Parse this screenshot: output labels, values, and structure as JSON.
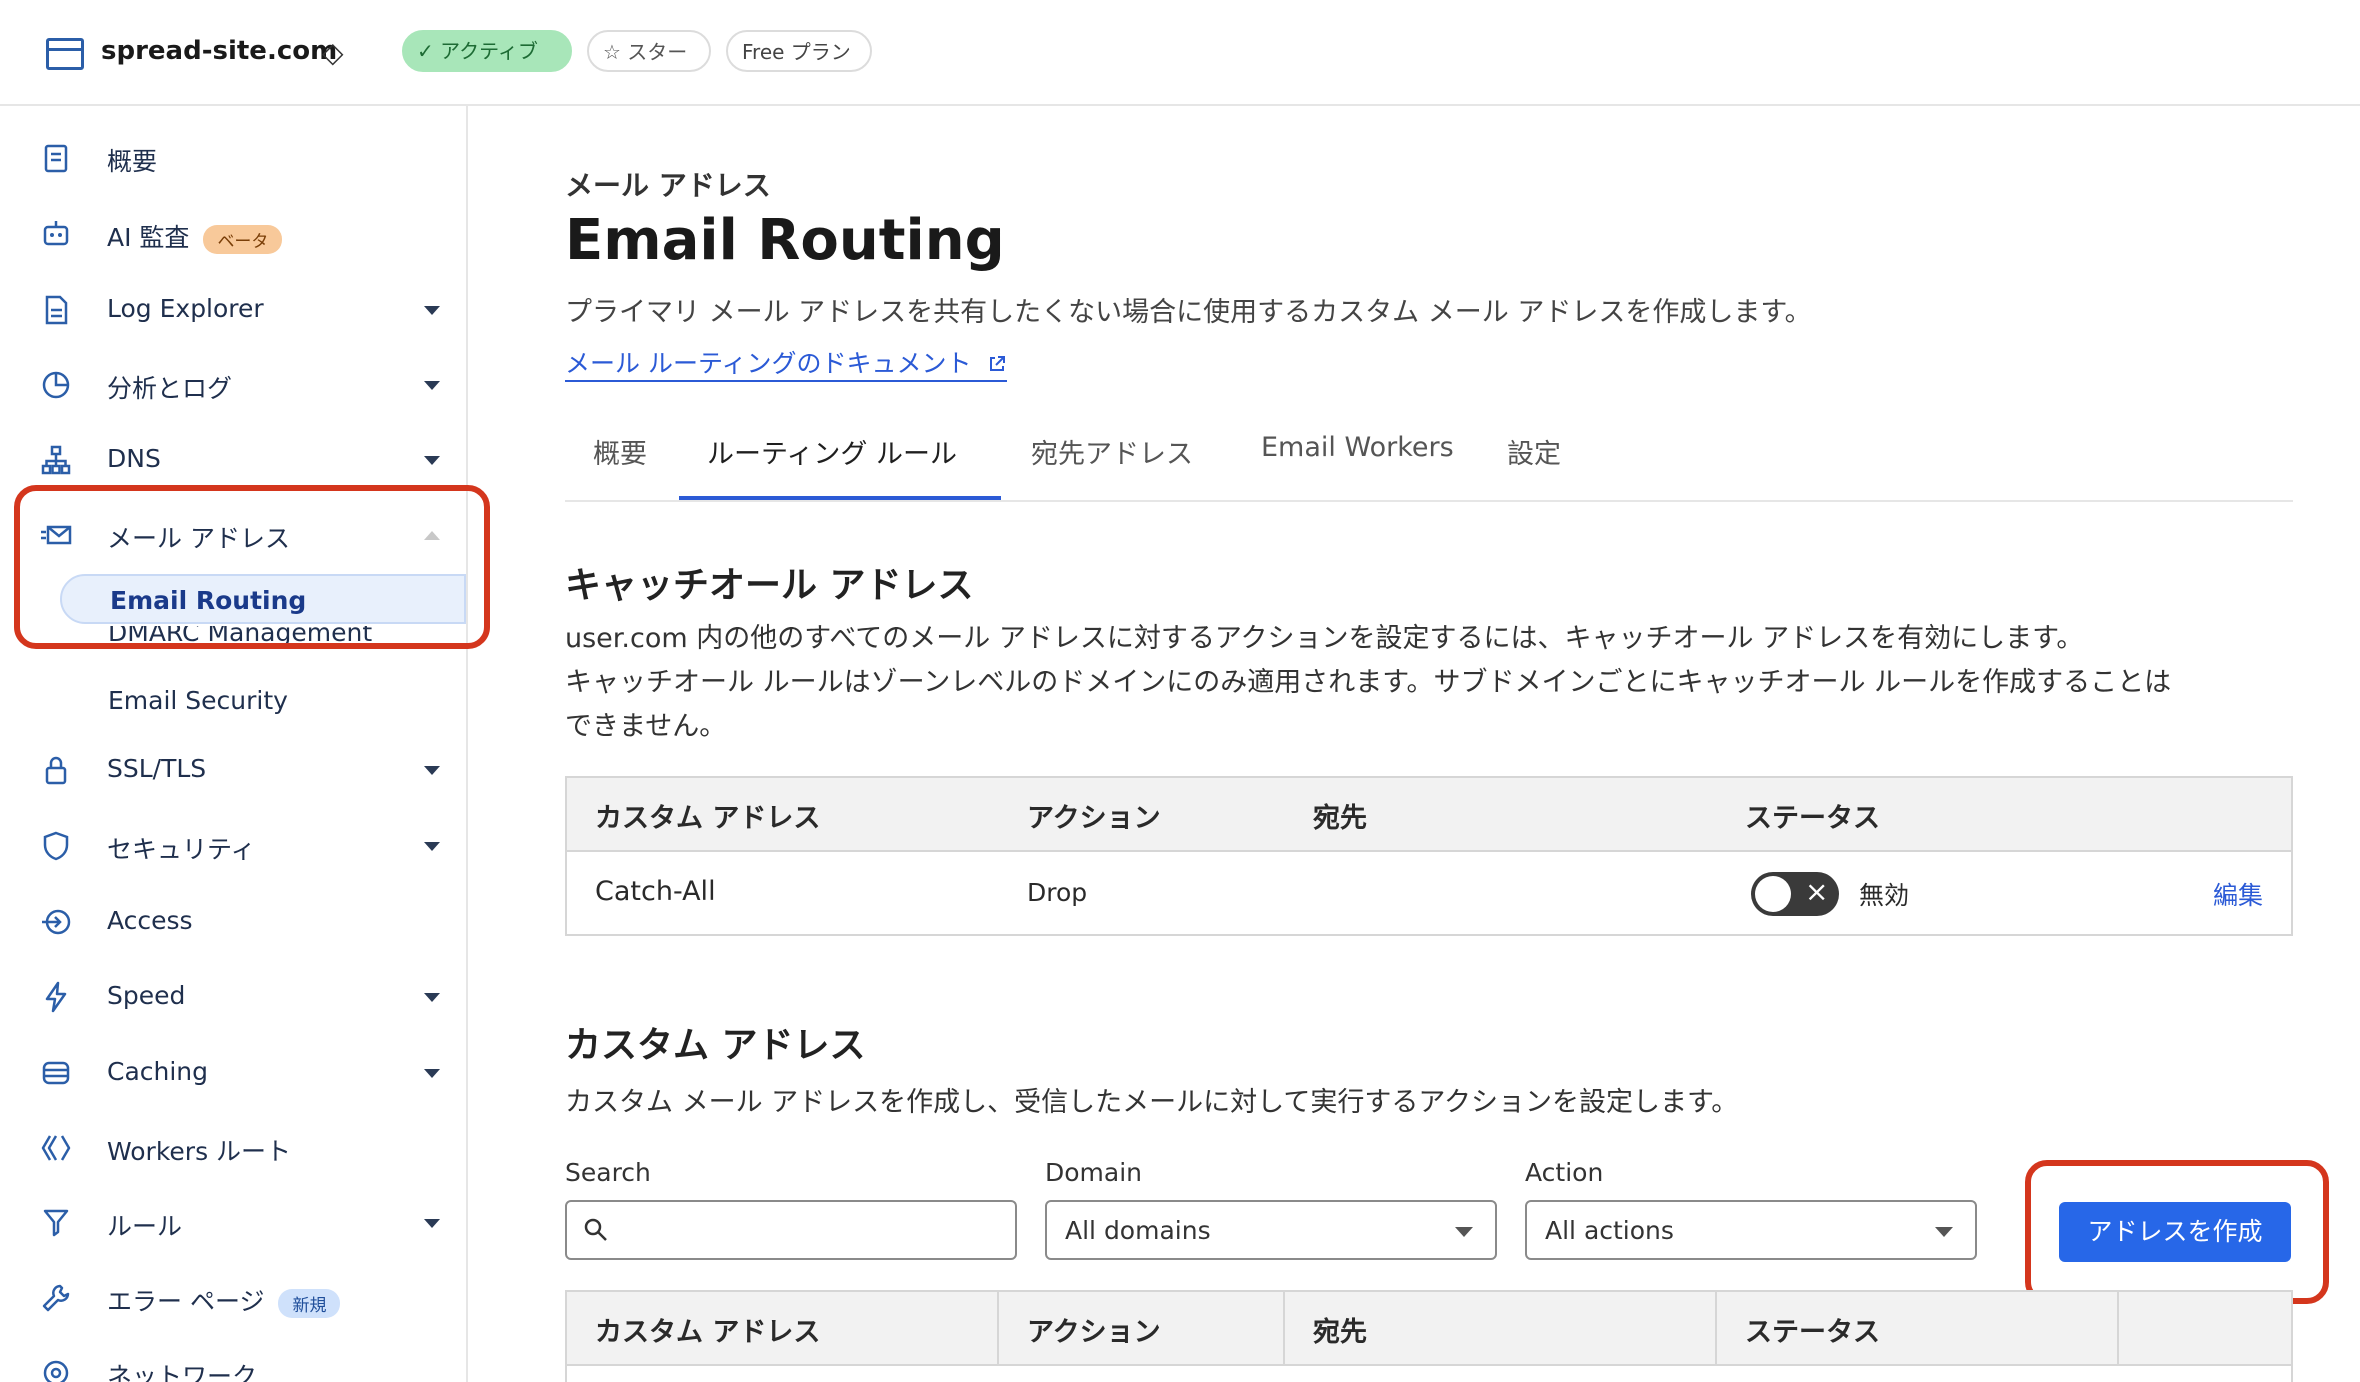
{
  "topbar": {
    "site_name": "spread-site.com",
    "switch_glyph": "◇",
    "status_pill": "✓ アクティブ",
    "star_pill": "☆ スター",
    "plan_pill": "Free プラン"
  },
  "sidebar": {
    "items": [
      {
        "label": "概要",
        "icon": "overview-icon"
      },
      {
        "label": "AI 監査",
        "badge": "ベータ",
        "icon": "robot-icon"
      },
      {
        "label": "Log Explorer",
        "icon": "log-icon"
      },
      {
        "label": "分析とログ",
        "icon": "pie-chart-icon"
      },
      {
        "label": "DNS",
        "icon": "network-icon"
      },
      {
        "label": "メール アドレス",
        "icon": "mail-icon"
      },
      {
        "label": "SSL/TLS",
        "icon": "lock-icon"
      },
      {
        "label": "セキュリティ",
        "icon": "shield-icon"
      },
      {
        "label": "Access",
        "icon": "access-icon"
      },
      {
        "label": "Speed",
        "icon": "bolt-icon"
      },
      {
        "label": "Caching",
        "icon": "storage-icon"
      },
      {
        "label": "Workers ルート",
        "icon": "workers-icon"
      },
      {
        "label": "ルール",
        "icon": "rules-icon"
      },
      {
        "label": "エラー ページ",
        "badge": "新規",
        "icon": "wrench-icon"
      },
      {
        "label": "ネットワーク",
        "icon": "location-icon"
      }
    ],
    "email_subitems": [
      "Email Routing",
      "DMARC Management",
      "Email Security"
    ]
  },
  "main": {
    "eyebrow": "メール アドレス",
    "title": "Email Routing",
    "description": "プライマリ メール アドレスを共有したくない場合に使用するカスタム メール アドレスを作成します。",
    "doc_link": "メール ルーティングのドキュメント",
    "tabs": [
      "概要",
      "ルーティング ルール",
      "宛先アドレス",
      "Email Workers",
      "設定"
    ],
    "catch_all": {
      "title": "キャッチオール アドレス",
      "line1": "user.com 内の他のすべてのメール アドレスに対するアクションを設定するには、キャッチオール アドレスを有効にします。",
      "line2": "キャッチオール ルールはゾーンレベルのドメインにのみ適用されます。サブドメインごとにキャッチオール ルールを作成することは",
      "line3": "できません。",
      "headers": [
        "カスタム アドレス",
        "アクション",
        "宛先",
        "ステータス"
      ],
      "row": {
        "address": "Catch-All",
        "action": "Drop",
        "destination": "",
        "status": "無効",
        "enabled": false,
        "edit": "編集"
      }
    },
    "custom": {
      "title": "カスタム アドレス",
      "description": "カスタム メール アドレスを作成し、受信したメールに対して実行するアクションを設定します。",
      "search_label": "Search",
      "search_value": "",
      "domain_label": "Domain",
      "domain_value": "All domains",
      "action_label": "Action",
      "action_value": "All actions",
      "create_button": "アドレスを作成",
      "headers": [
        "カスタム アドレス",
        "アクション",
        "宛先",
        "ステータス"
      ]
    }
  },
  "colors": {
    "accent": "#2767e8",
    "highlight": "#d4361d",
    "active_pill": "#a8e6b9"
  }
}
